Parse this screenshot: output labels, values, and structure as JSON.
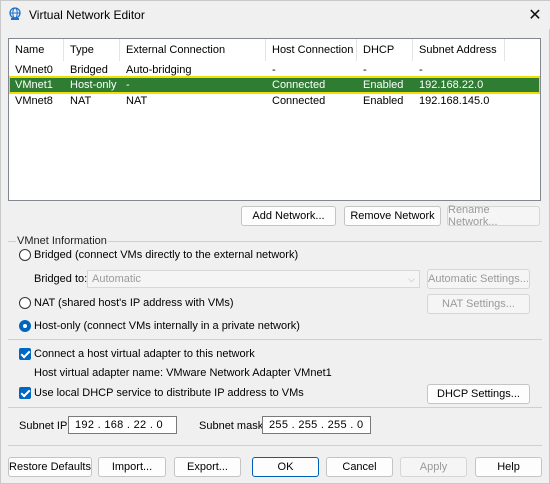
{
  "window": {
    "title": "Virtual Network Editor"
  },
  "icons": {
    "app": "network-globe-icon",
    "close": "close-icon"
  },
  "colors": {
    "selected_row": "#2e7d32",
    "selected_outline": "#f0e000",
    "accent": "#0067c0"
  },
  "table": {
    "columns": [
      "Name",
      "Type",
      "External Connection",
      "Host Connection",
      "DHCP",
      "Subnet Address"
    ],
    "rows": [
      [
        "VMnet0",
        "Bridged",
        "Auto-bridging",
        "-",
        "-",
        "-"
      ],
      [
        "VMnet1",
        "Host-only",
        "-",
        "Connected",
        "Enabled",
        "192.168.22.0"
      ],
      [
        "VMnet8",
        "NAT",
        "NAT",
        "Connected",
        "Enabled",
        "192.168.145.0"
      ]
    ],
    "selected_index": 1
  },
  "list_buttons": {
    "add": "Add Network...",
    "remove": "Remove Network",
    "rename": "Rename Network..."
  },
  "vmnet_info": {
    "legend": "VMnet Information",
    "bridged_label": "Bridged (connect VMs directly to the external network)",
    "bridged_to_label": "Bridged to:",
    "bridged_to_value": "Automatic",
    "automatic_settings": "Automatic Settings...",
    "nat_label": "NAT (shared host's IP address with VMs)",
    "nat_settings": "NAT Settings...",
    "hostonly_label": "Host-only (connect VMs internally in a private network)",
    "selected_mode": "host-only",
    "connect_adapter_label": "Connect a host virtual adapter to this network",
    "connect_adapter_checked": true,
    "adapter_name_label": "Host virtual adapter name: VMware Network Adapter VMnet1",
    "dhcp_label": "Use local DHCP service to distribute IP address to VMs",
    "dhcp_checked": true,
    "dhcp_settings": "DHCP Settings...",
    "subnet_ip_label": "Subnet IP:",
    "subnet_ip_value": "192 . 168 .  22  .  0",
    "subnet_mask_label": "Subnet mask:",
    "subnet_mask_value": "255 . 255 . 255 .  0"
  },
  "footer": {
    "restore": "Restore Defaults",
    "import": "Import...",
    "export": "Export...",
    "ok": "OK",
    "cancel": "Cancel",
    "apply": "Apply",
    "help": "Help"
  }
}
